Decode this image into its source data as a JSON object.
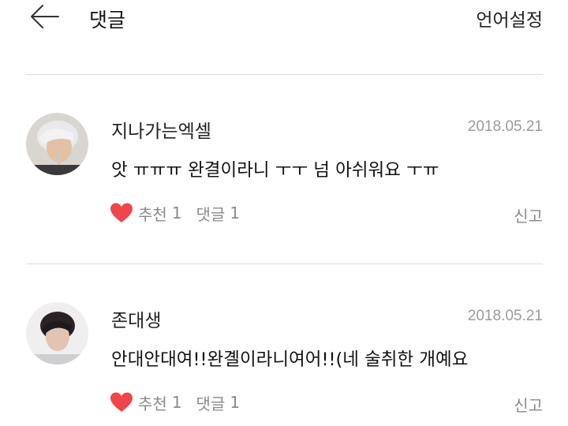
{
  "header": {
    "title": "댓글",
    "language_label": "언어설정",
    "back_icon": "arrow-left-icon"
  },
  "comments": [
    {
      "username": "지나가는엑셀",
      "date": "2018.05.21",
      "text": "앗 ㅠㅠㅠ 완결이라니 ㅜㅜ 넘 아쉬워요 ㅜㅠ",
      "like_label": "추천",
      "like_count": "1",
      "reply_label": "댓글",
      "reply_count": "1",
      "report_label": "신고",
      "heart_color": "#f0464b"
    },
    {
      "username": "존대생",
      "date": "2018.05.21",
      "text": "안대안대여!!완곌이라니여어!!(네 술취한 개예요",
      "like_label": "추천",
      "like_count": "1",
      "reply_label": "댓글",
      "reply_count": "1",
      "report_label": "신고",
      "heart_color": "#f0464b"
    }
  ]
}
